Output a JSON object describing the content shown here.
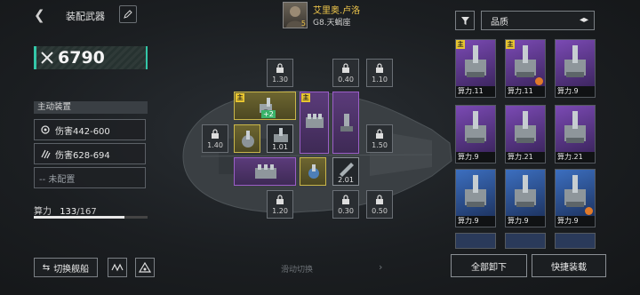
{
  "header": {
    "title": "装配武器",
    "pilot_name": "艾里奥.卢洛",
    "pilot_level": "5",
    "ship_name": "G8.天蝎座"
  },
  "left": {
    "power_value": "6790",
    "section_label": "主动装置",
    "slots": [
      {
        "label": "伤害442-600",
        "icon": "gear-icon"
      },
      {
        "label": "伤害628-694",
        "icon": "claw-icon"
      },
      {
        "label": "-- 未配置",
        "icon": "none"
      }
    ],
    "capacity_label": "算力",
    "capacity_used": "133",
    "capacity_total": "/167",
    "capacity_fraction": 0.796,
    "switch_ship_label": "切换舰船"
  },
  "grid": {
    "swipe_hint": "滑动切换",
    "locked_values": [
      "1.30",
      "0.40",
      "1.10",
      "1.40",
      "1.50",
      "1.20",
      "0.30",
      "0.50"
    ],
    "placed_values": [
      "1.01",
      "2.01"
    ],
    "main_tag": "主",
    "plus_tag": "+2"
  },
  "right": {
    "sort_label": "品质",
    "cards": [
      {
        "label": "算力.11",
        "tier": "epic",
        "tag": true,
        "badge": false
      },
      {
        "label": "算力.11",
        "tier": "epic",
        "tag": true,
        "badge": true
      },
      {
        "label": "算力.9",
        "tier": "epic",
        "tag": false,
        "badge": false
      },
      {
        "label": "算力.9",
        "tier": "epic",
        "tag": false,
        "badge": false
      },
      {
        "label": "算力.21",
        "tier": "epic",
        "tag": false,
        "badge": false
      },
      {
        "label": "算力.21",
        "tier": "epic",
        "tag": false,
        "badge": false
      },
      {
        "label": "算力.9",
        "tier": "rare",
        "tag": false,
        "badge": false
      },
      {
        "label": "算力.9",
        "tier": "rare",
        "tag": false,
        "badge": false
      },
      {
        "label": "算力.9",
        "tier": "rare",
        "tag": false,
        "badge": true
      }
    ],
    "unequip_all_label": "全部卸下",
    "quick_equip_label": "快捷装载"
  },
  "colors": {
    "accent": "#34c7a8",
    "main_tag": "#e8c530",
    "epic": "#7b4ab4",
    "rare": "#3c6fc0"
  }
}
